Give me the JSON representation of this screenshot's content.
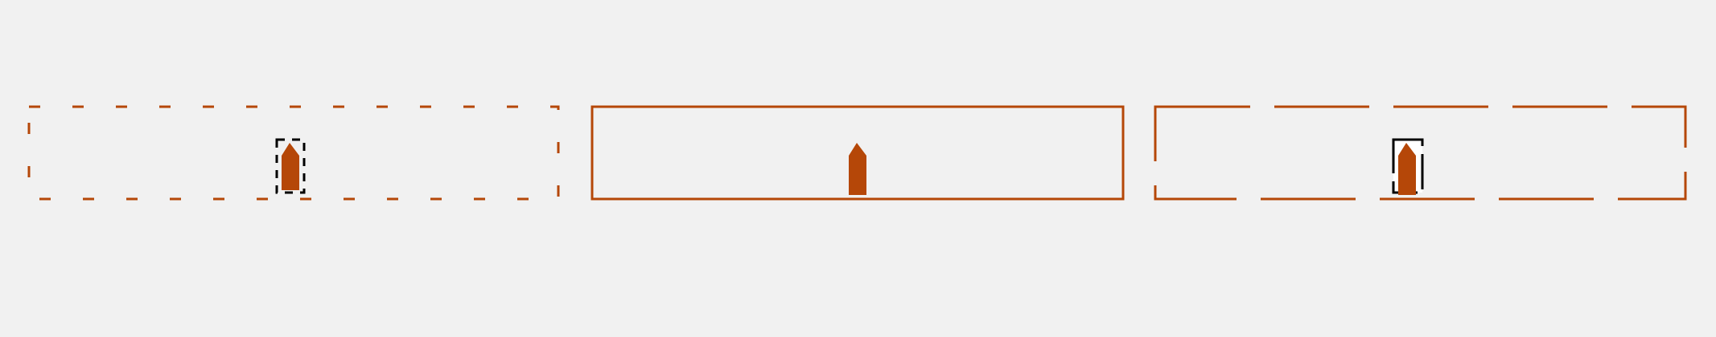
{
  "colors": {
    "background": "#f1f1f1",
    "frame_stroke": "#b54708",
    "marker_fill": "#b54708",
    "focus_stroke": "#000000",
    "focus_fill": "#ffffff"
  },
  "panels": [
    {
      "id": "panel-1",
      "frame_style": "dashed-short",
      "marker": "pin-marker-icon",
      "focus_box": "dashed-short"
    },
    {
      "id": "panel-2",
      "frame_style": "solid",
      "marker": "pin-marker-icon",
      "focus_box": "none"
    },
    {
      "id": "panel-3",
      "frame_style": "dashed-long",
      "marker": "pin-marker-icon",
      "focus_box": "dashed-long"
    }
  ]
}
